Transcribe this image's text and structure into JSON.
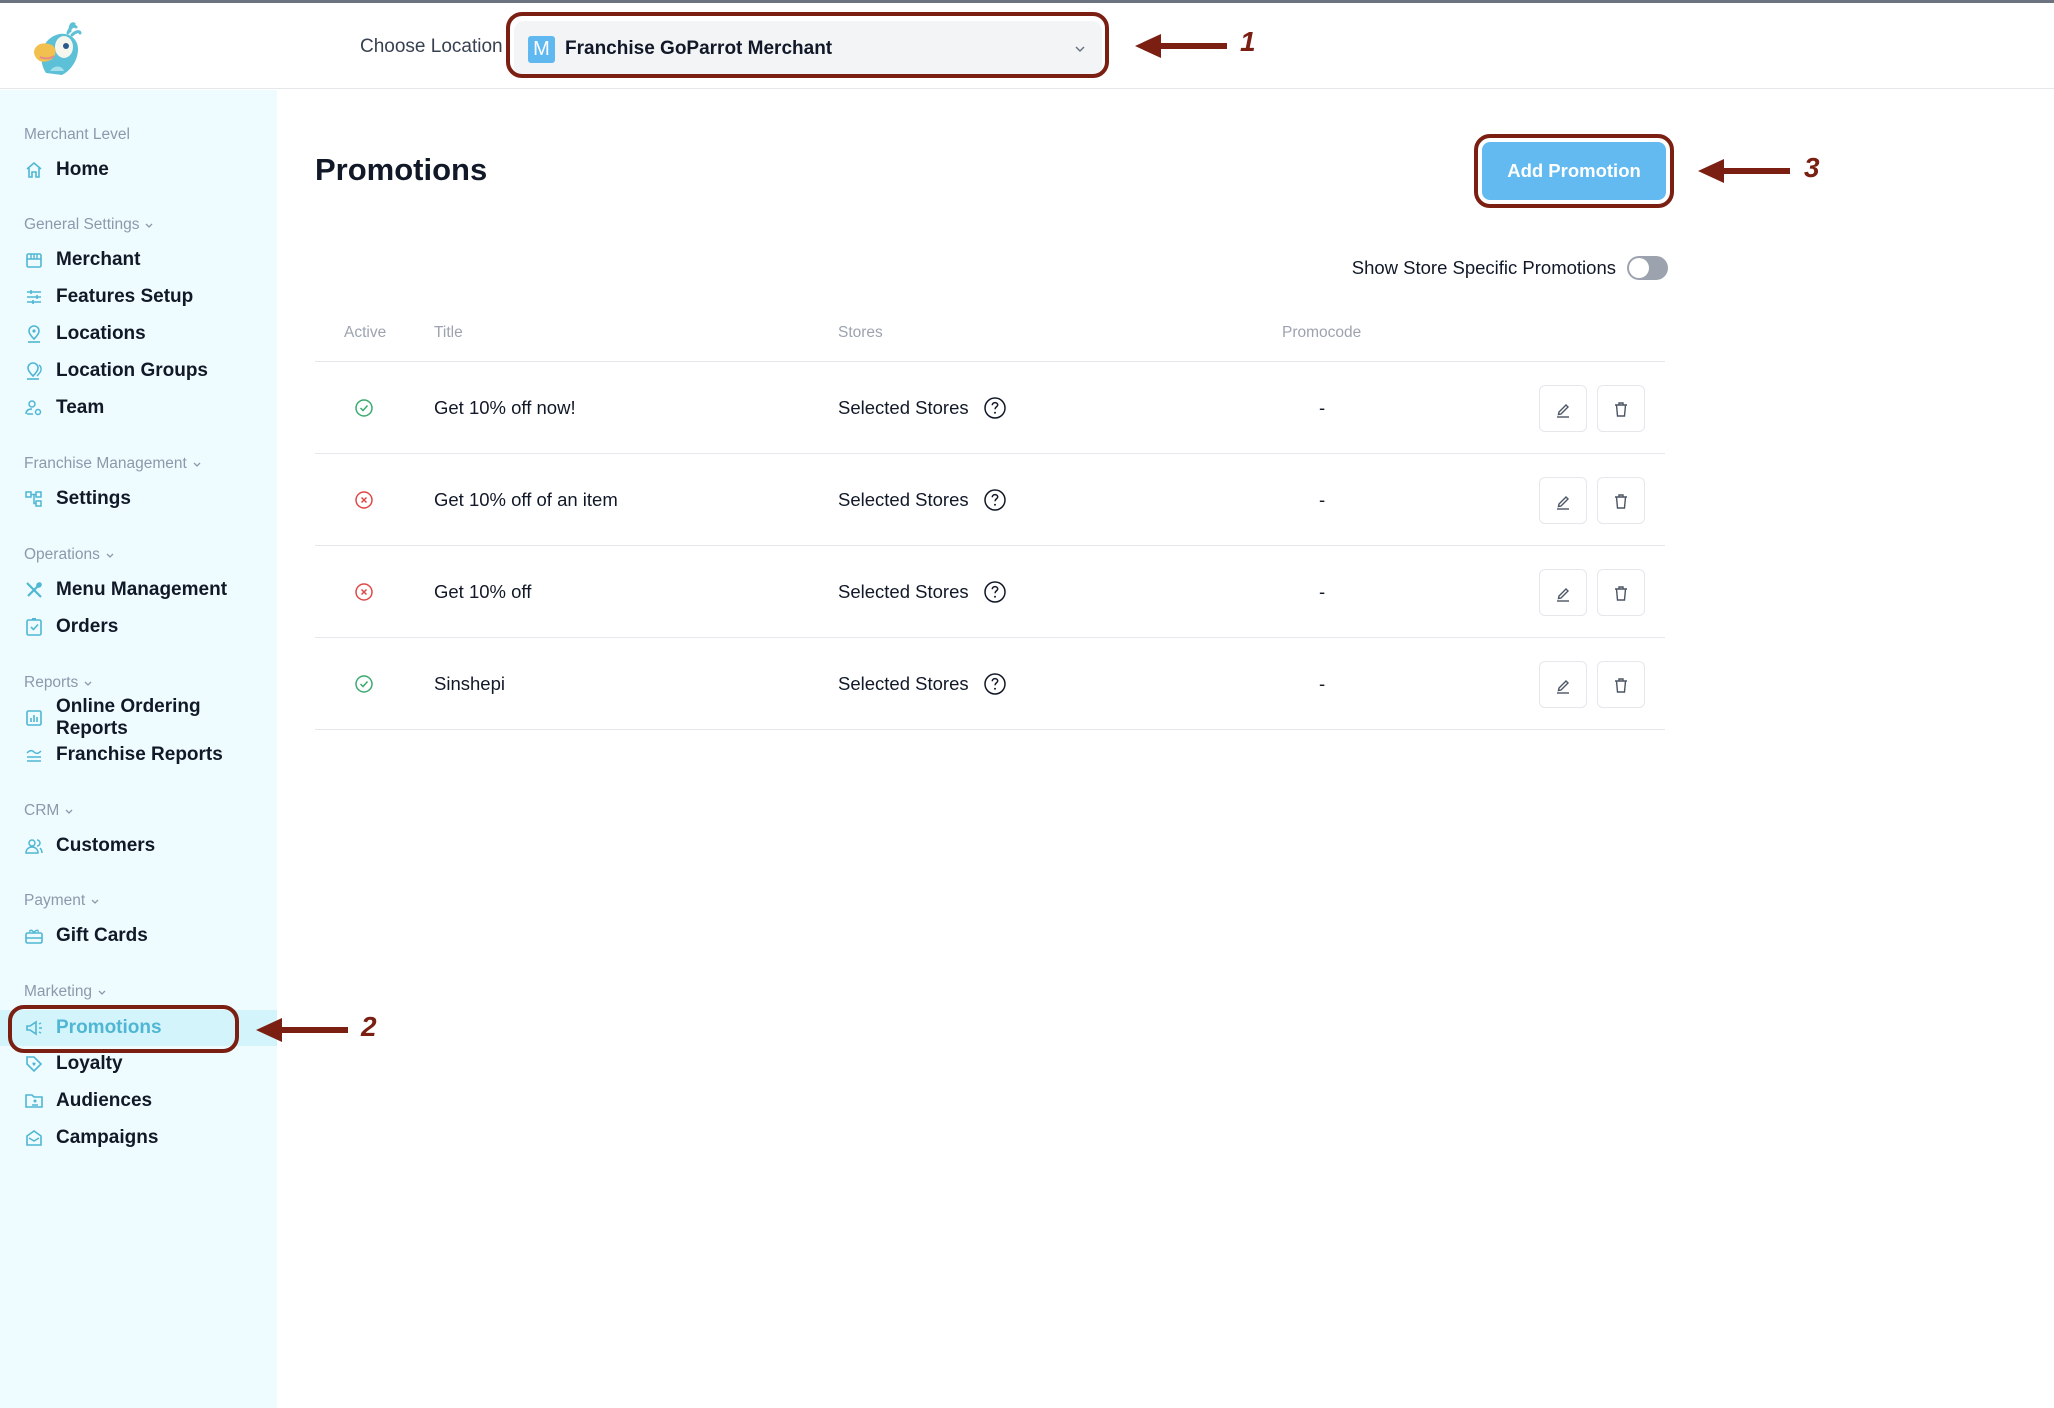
{
  "header": {
    "logo": "goparrot-parrot-logo",
    "choose_location_label": "Choose Location",
    "location": {
      "badge": "M",
      "selected": "Franchise GoParrot Merchant"
    }
  },
  "sidebar": {
    "groups": [
      {
        "label": "Merchant Level",
        "collapsible": false,
        "items": [
          {
            "label": "Home",
            "icon": "home-icon"
          }
        ]
      },
      {
        "label": "General Settings",
        "collapsible": true,
        "items": [
          {
            "label": "Merchant",
            "icon": "storefront-icon"
          },
          {
            "label": "Features Setup",
            "icon": "sliders-icon"
          },
          {
            "label": "Locations",
            "icon": "map-pin-icon"
          },
          {
            "label": "Location Groups",
            "icon": "map-pins-icon"
          },
          {
            "label": "Team",
            "icon": "user-settings-icon"
          }
        ]
      },
      {
        "label": "Franchise Management",
        "collapsible": true,
        "items": [
          {
            "label": "Settings",
            "icon": "hierarchy-icon"
          }
        ]
      },
      {
        "label": "Operations",
        "collapsible": true,
        "items": [
          {
            "label": "Menu Management",
            "icon": "utensils-icon"
          },
          {
            "label": "Orders",
            "icon": "clipboard-check-icon"
          }
        ]
      },
      {
        "label": "Reports",
        "collapsible": true,
        "items": [
          {
            "label": "Online Ordering Reports",
            "icon": "bar-chart-icon"
          },
          {
            "label": "Franchise Reports",
            "icon": "waves-icon"
          }
        ]
      },
      {
        "label": "CRM",
        "collapsible": true,
        "items": [
          {
            "label": "Customers",
            "icon": "users-icon"
          }
        ]
      },
      {
        "label": "Payment",
        "collapsible": true,
        "items": [
          {
            "label": "Gift Cards",
            "icon": "gift-card-icon"
          }
        ]
      },
      {
        "label": "Marketing",
        "collapsible": true,
        "items": [
          {
            "label": "Promotions",
            "icon": "megaphone-icon",
            "active": true
          },
          {
            "label": "Loyalty",
            "icon": "tag-heart-icon"
          },
          {
            "label": "Audiences",
            "icon": "folder-user-icon"
          },
          {
            "label": "Campaigns",
            "icon": "envelope-open-icon"
          }
        ]
      }
    ]
  },
  "main": {
    "title": "Promotions",
    "add_button": "Add Promotion",
    "toggle": {
      "label": "Show Store Specific Promotions",
      "on": false
    },
    "table": {
      "columns": [
        "Active",
        "Title",
        "Stores",
        "Promocode"
      ],
      "rows": [
        {
          "active": true,
          "title": "Get 10% off now!",
          "stores": "Selected Stores",
          "promocode": "-"
        },
        {
          "active": false,
          "title": "Get 10% off of an item",
          "stores": "Selected Stores",
          "promocode": "-"
        },
        {
          "active": false,
          "title": "Get 10% off",
          "stores": "Selected Stores",
          "promocode": "-"
        },
        {
          "active": true,
          "title": "Sinshepi",
          "stores": "Selected Stores",
          "promocode": "-"
        }
      ]
    }
  },
  "annotations": [
    {
      "number": "1",
      "target": "location-select"
    },
    {
      "number": "2",
      "target": "sidebar-item-promotions"
    },
    {
      "number": "3",
      "target": "add-promotion-button"
    }
  ],
  "colors": {
    "accent": "#4fb6d4",
    "button": "#62baf1",
    "active_green": "#3aaa6e",
    "inactive_red": "#e04848",
    "annotation": "#7a1f12",
    "sidebar_bg": "#effcff"
  }
}
